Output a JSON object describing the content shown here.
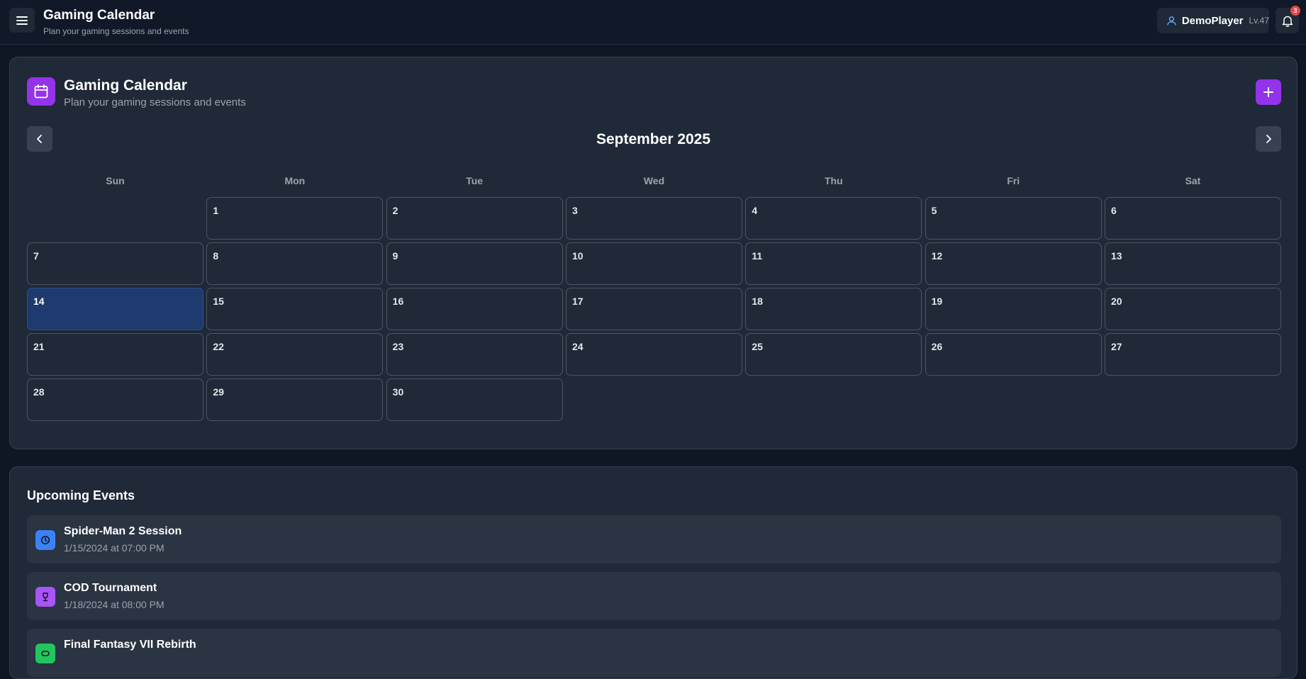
{
  "header": {
    "title": "Gaming Calendar",
    "subtitle": "Plan your gaming sessions and events",
    "user": {
      "name": "DemoPlayer",
      "level": "Lv.47"
    },
    "notification_count": "3"
  },
  "calendar": {
    "title": "Gaming Calendar",
    "subtitle": "Plan your gaming sessions and events",
    "month_label": "September 2025",
    "weekdays": [
      "Sun",
      "Mon",
      "Tue",
      "Wed",
      "Thu",
      "Fri",
      "Sat"
    ],
    "today": 14,
    "days": [
      "",
      "1",
      "2",
      "3",
      "4",
      "5",
      "6",
      "7",
      "8",
      "9",
      "10",
      "11",
      "12",
      "13",
      "14",
      "15",
      "16",
      "17",
      "18",
      "19",
      "20",
      "21",
      "22",
      "23",
      "24",
      "25",
      "26",
      "27",
      "28",
      "29",
      "30"
    ]
  },
  "upcoming": {
    "title": "Upcoming Events",
    "events": [
      {
        "name": "Spider-Man 2 Session",
        "when": "1/15/2024 at 07:00 PM",
        "icon": "clock-icon",
        "color": "#3b82f6"
      },
      {
        "name": "COD Tournament",
        "when": "1/18/2024 at 08:00 PM",
        "icon": "trophy-icon",
        "color": "#a855f7"
      },
      {
        "name": "Final Fantasy VII Rebirth",
        "when": "",
        "icon": "game-icon",
        "color": "#22c55e"
      }
    ]
  },
  "colors": {
    "accent": "#9333ea",
    "today_bg": "#1e3a6e",
    "background": "#0f1624",
    "card": "#1f2937"
  }
}
